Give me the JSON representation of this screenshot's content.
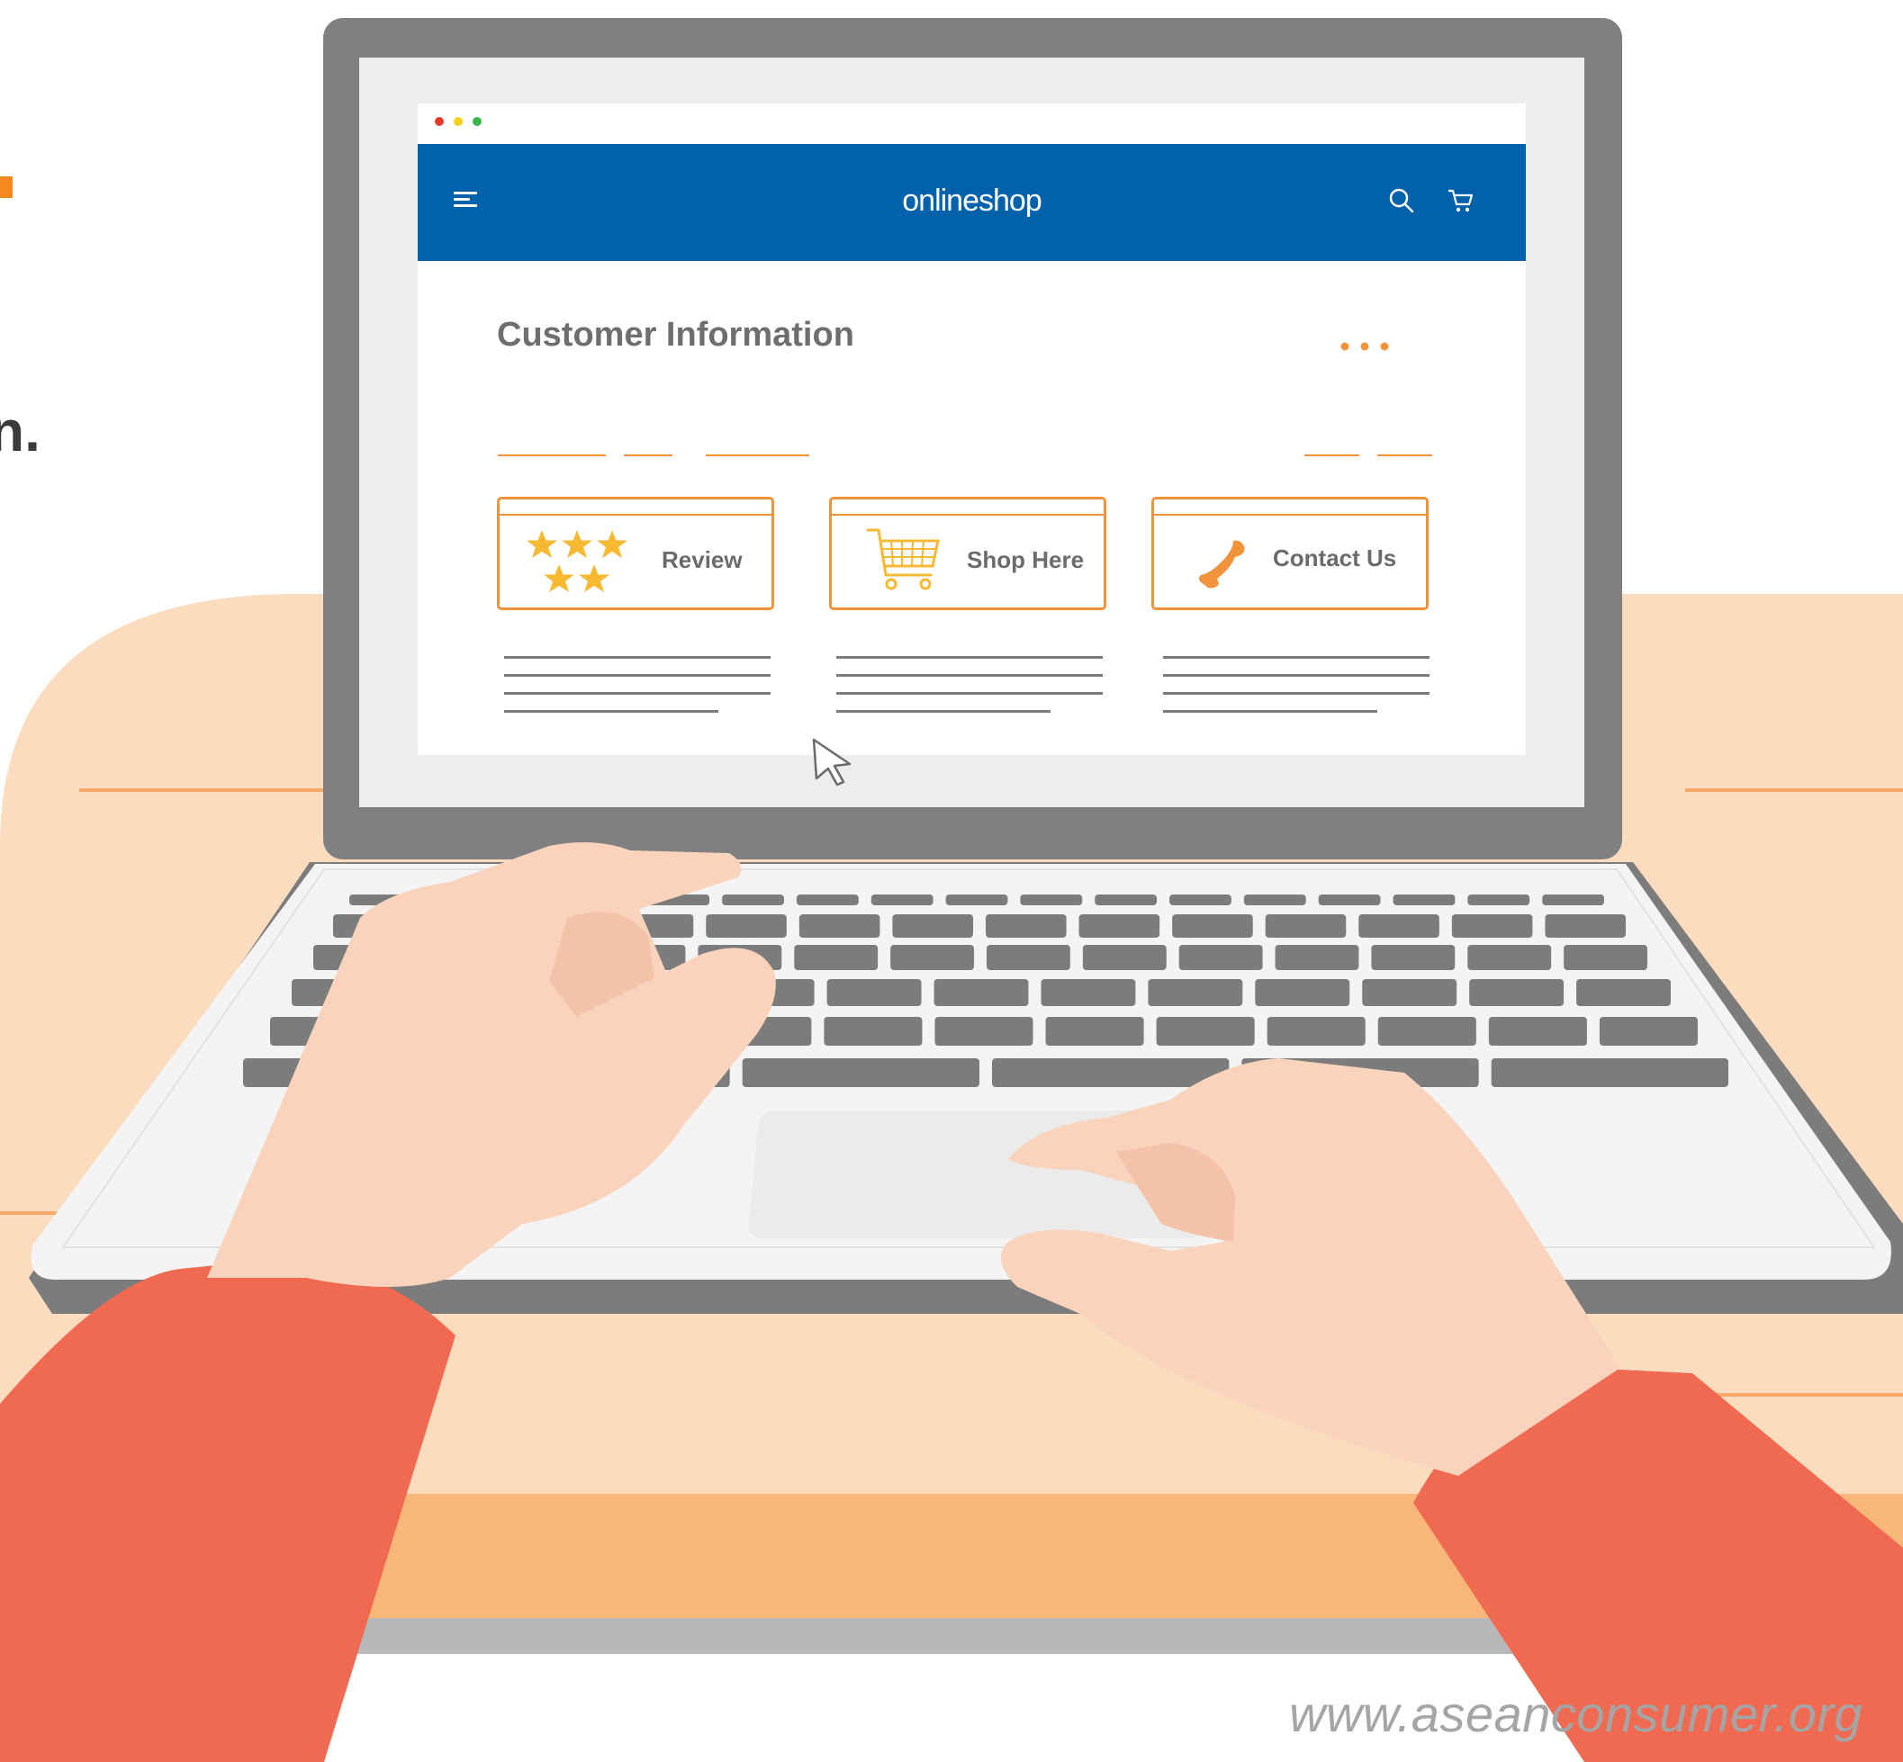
{
  "browser": {
    "window_dots": [
      "#e03b2e",
      "#f6d21a",
      "#3cb64a"
    ],
    "brand": "onlineshop",
    "menu_icon": "hamburger-menu-icon",
    "search_icon": "search-icon",
    "cart_icon": "cart-icon",
    "nav_color": "#0161aa"
  },
  "page": {
    "title": "Customer Information",
    "more_icon": "more-dots-icon",
    "cards": [
      {
        "label": "Review",
        "icon": "five-stars-icon"
      },
      {
        "label": "Shop Here",
        "icon": "shopping-cart-icon"
      },
      {
        "label": "Contact Us",
        "icon": "phone-icon"
      }
    ]
  },
  "background": {
    "partial_heading": "n.",
    "accent_color": "#f0933a"
  },
  "footer": {
    "watermark": "www.aseanconsumer.org"
  }
}
